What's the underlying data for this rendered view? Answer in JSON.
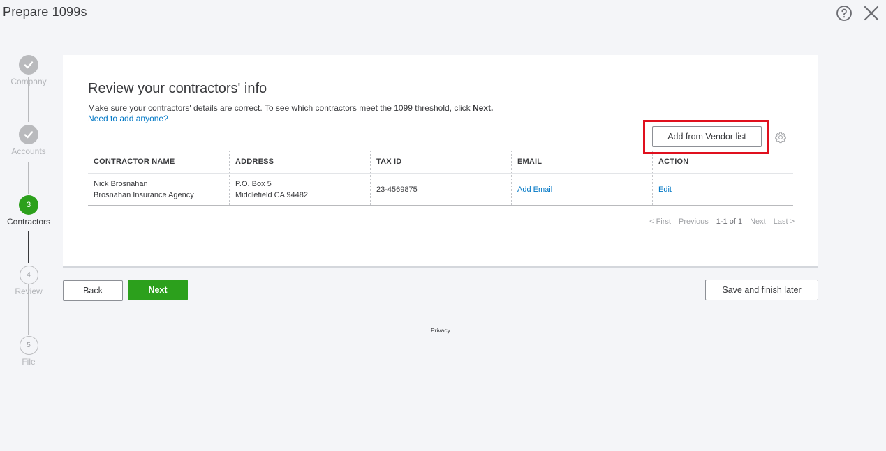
{
  "header": {
    "title": "Prepare 1099s"
  },
  "stepper": {
    "steps": [
      {
        "label": "Company",
        "status": "done",
        "number": ""
      },
      {
        "label": "Accounts",
        "status": "done",
        "number": ""
      },
      {
        "label": "Contractors",
        "status": "active",
        "number": "3"
      },
      {
        "label": "Review",
        "status": "future",
        "number": "4"
      },
      {
        "label": "File",
        "status": "future",
        "number": "5"
      }
    ]
  },
  "main": {
    "title": "Review your contractors' info",
    "description": "Make sure your contractors' details are correct. To see which contractors meet the 1099 threshold, click ",
    "description_bold": "Next.",
    "need_link": "Need to add anyone?",
    "vendor_button": "Add from Vendor list",
    "table": {
      "headers": [
        "CONTRACTOR NAME",
        "ADDRESS",
        "TAX ID",
        "EMAIL",
        "ACTION"
      ],
      "rows": [
        {
          "name": "Nick Brosnahan",
          "company": "Brosnahan Insurance Agency",
          "address_line1": "P.O. Box 5",
          "address_line2": "Middlefield CA 94482",
          "tax_id": "23-4569875",
          "email": "Add Email",
          "action": "Edit"
        }
      ]
    },
    "pagination": {
      "first": "< First",
      "previous": "Previous",
      "range": "1-1 of 1",
      "next": "Next",
      "last": "Last >"
    }
  },
  "footer": {
    "back": "Back",
    "next": "Next",
    "save": "Save and finish later",
    "privacy": "Privacy"
  },
  "colors": {
    "accent": "#2ca01c",
    "link": "#0077c5",
    "highlight": "#e0101e"
  }
}
